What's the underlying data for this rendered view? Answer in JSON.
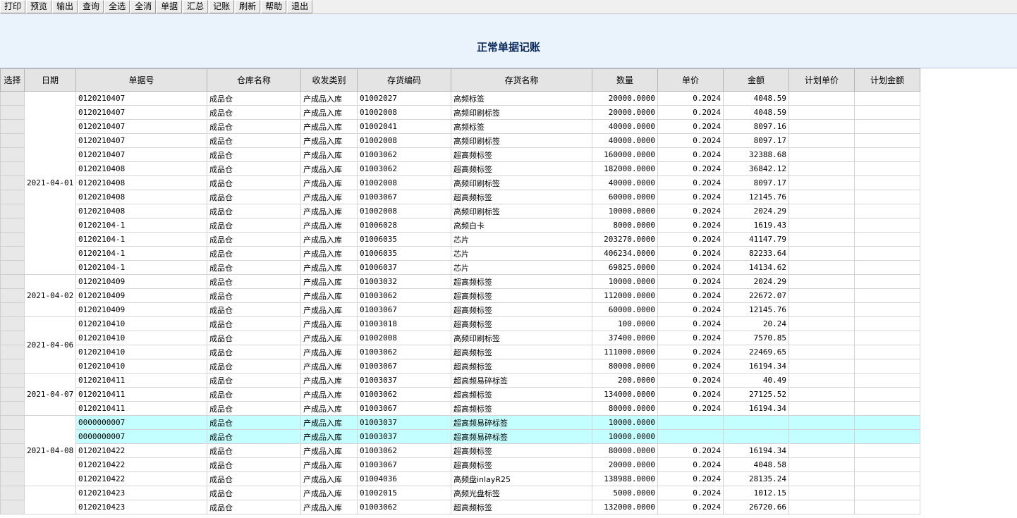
{
  "toolbar": {
    "buttons": [
      "打印",
      "预览",
      "输出",
      "查询",
      "全选",
      "全消",
      "单据",
      "汇总",
      "记账",
      "刷新",
      "帮助",
      "退出"
    ]
  },
  "page": {
    "title": "正常单据记账"
  },
  "table": {
    "columns": [
      "选择",
      "日期",
      "单据号",
      "仓库名称",
      "收发类别",
      "存货编码",
      "存货名称",
      "数量",
      "单价",
      "金额",
      "计划单价",
      "计划金额"
    ],
    "groups": [
      {
        "date": "2021-04-01",
        "rows": [
          {
            "no": "0120210407",
            "wh": "成品仓",
            "type": "产成品入库",
            "code": "01002027",
            "name": "高频标签",
            "qty": "20000.0000",
            "price": "0.2024",
            "amt": "4048.59",
            "hl": false
          },
          {
            "no": "0120210407",
            "wh": "成品仓",
            "type": "产成品入库",
            "code": "01002008",
            "name": "高频印刷标签",
            "qty": "20000.0000",
            "price": "0.2024",
            "amt": "4048.59",
            "hl": false
          },
          {
            "no": "0120210407",
            "wh": "成品仓",
            "type": "产成品入库",
            "code": "01002041",
            "name": "高频标签",
            "qty": "40000.0000",
            "price": "0.2024",
            "amt": "8097.16",
            "hl": false
          },
          {
            "no": "0120210407",
            "wh": "成品仓",
            "type": "产成品入库",
            "code": "01002008",
            "name": "高频印刷标签",
            "qty": "40000.0000",
            "price": "0.2024",
            "amt": "8097.17",
            "hl": false
          },
          {
            "no": "0120210407",
            "wh": "成品仓",
            "type": "产成品入库",
            "code": "01003062",
            "name": "超高频标签",
            "qty": "160000.0000",
            "price": "0.2024",
            "amt": "32388.68",
            "hl": false
          },
          {
            "no": "0120210408",
            "wh": "成品仓",
            "type": "产成品入库",
            "code": "01003062",
            "name": "超高频标签",
            "qty": "182000.0000",
            "price": "0.2024",
            "amt": "36842.12",
            "hl": false
          },
          {
            "no": "0120210408",
            "wh": "成品仓",
            "type": "产成品入库",
            "code": "01002008",
            "name": "高频印刷标签",
            "qty": "40000.0000",
            "price": "0.2024",
            "amt": "8097.17",
            "hl": false
          },
          {
            "no": "0120210408",
            "wh": "成品仓",
            "type": "产成品入库",
            "code": "01003067",
            "name": "超高频标签",
            "qty": "60000.0000",
            "price": "0.2024",
            "amt": "12145.76",
            "hl": false
          },
          {
            "no": "0120210408",
            "wh": "成品仓",
            "type": "产成品入库",
            "code": "01002008",
            "name": "高频印刷标签",
            "qty": "10000.0000",
            "price": "0.2024",
            "amt": "2024.29",
            "hl": false
          },
          {
            "no": "01202104-1",
            "wh": "成品仓",
            "type": "产成品入库",
            "code": "01006028",
            "name": "高频白卡",
            "qty": "8000.0000",
            "price": "0.2024",
            "amt": "1619.43",
            "hl": false
          },
          {
            "no": "01202104-1",
            "wh": "成品仓",
            "type": "产成品入库",
            "code": "01006035",
            "name": "芯片",
            "qty": "203270.0000",
            "price": "0.2024",
            "amt": "41147.79",
            "hl": false
          },
          {
            "no": "01202104-1",
            "wh": "成品仓",
            "type": "产成品入库",
            "code": "01006035",
            "name": "芯片",
            "qty": "406234.0000",
            "price": "0.2024",
            "amt": "82233.64",
            "hl": false
          },
          {
            "no": "01202104-1",
            "wh": "成品仓",
            "type": "产成品入库",
            "code": "01006037",
            "name": "芯片",
            "qty": "69825.0000",
            "price": "0.2024",
            "amt": "14134.62",
            "hl": false
          }
        ]
      },
      {
        "date": "2021-04-02",
        "rows": [
          {
            "no": "0120210409",
            "wh": "成品仓",
            "type": "产成品入库",
            "code": "01003032",
            "name": "超高频标签",
            "qty": "10000.0000",
            "price": "0.2024",
            "amt": "2024.29",
            "hl": false
          },
          {
            "no": "0120210409",
            "wh": "成品仓",
            "type": "产成品入库",
            "code": "01003062",
            "name": "超高频标签",
            "qty": "112000.0000",
            "price": "0.2024",
            "amt": "22672.07",
            "hl": false
          },
          {
            "no": "0120210409",
            "wh": "成品仓",
            "type": "产成品入库",
            "code": "01003067",
            "name": "超高频标签",
            "qty": "60000.0000",
            "price": "0.2024",
            "amt": "12145.76",
            "hl": false
          }
        ]
      },
      {
        "date": "2021-04-06",
        "rows": [
          {
            "no": "0120210410",
            "wh": "成品仓",
            "type": "产成品入库",
            "code": "01003018",
            "name": "超高频标签",
            "qty": "100.0000",
            "price": "0.2024",
            "amt": "20.24",
            "hl": false
          },
          {
            "no": "0120210410",
            "wh": "成品仓",
            "type": "产成品入库",
            "code": "01002008",
            "name": "高频印刷标签",
            "qty": "37400.0000",
            "price": "0.2024",
            "amt": "7570.85",
            "hl": false
          },
          {
            "no": "0120210410",
            "wh": "成品仓",
            "type": "产成品入库",
            "code": "01003062",
            "name": "超高频标签",
            "qty": "111000.0000",
            "price": "0.2024",
            "amt": "22469.65",
            "hl": false
          },
          {
            "no": "0120210410",
            "wh": "成品仓",
            "type": "产成品入库",
            "code": "01003067",
            "name": "超高频标签",
            "qty": "80000.0000",
            "price": "0.2024",
            "amt": "16194.34",
            "hl": false
          }
        ]
      },
      {
        "date": "2021-04-07",
        "rows": [
          {
            "no": "0120210411",
            "wh": "成品仓",
            "type": "产成品入库",
            "code": "01003037",
            "name": "超高频易碎标签",
            "qty": "200.0000",
            "price": "0.2024",
            "amt": "40.49",
            "hl": false
          },
          {
            "no": "0120210411",
            "wh": "成品仓",
            "type": "产成品入库",
            "code": "01003062",
            "name": "超高频标签",
            "qty": "134000.0000",
            "price": "0.2024",
            "amt": "27125.52",
            "hl": false
          },
          {
            "no": "0120210411",
            "wh": "成品仓",
            "type": "产成品入库",
            "code": "01003067",
            "name": "超高频标签",
            "qty": "80000.0000",
            "price": "0.2024",
            "amt": "16194.34",
            "hl": false
          }
        ]
      },
      {
        "date": "2021-04-08",
        "rows": [
          {
            "no": "0000000007",
            "wh": "成品仓",
            "type": "产成品入库",
            "code": "01003037",
            "name": "超高频易碎标签",
            "qty": "10000.0000",
            "price": "",
            "amt": "",
            "hl": true
          },
          {
            "no": "0000000007",
            "wh": "成品仓",
            "type": "产成品入库",
            "code": "01003037",
            "name": "超高频易碎标签",
            "qty": "10000.0000",
            "price": "",
            "amt": "",
            "hl": true
          },
          {
            "no": "0120210422",
            "wh": "成品仓",
            "type": "产成品入库",
            "code": "01003062",
            "name": "超高频标签",
            "qty": "80000.0000",
            "price": "0.2024",
            "amt": "16194.34",
            "hl": false
          },
          {
            "no": "0120210422",
            "wh": "成品仓",
            "type": "产成品入库",
            "code": "01003067",
            "name": "超高频标签",
            "qty": "20000.0000",
            "price": "0.2024",
            "amt": "4048.58",
            "hl": false
          },
          {
            "no": "0120210422",
            "wh": "成品仓",
            "type": "产成品入库",
            "code": "01004036",
            "name": "高频盘inlayR25",
            "qty": "138988.0000",
            "price": "0.2024",
            "amt": "28135.24",
            "hl": false
          }
        ]
      },
      {
        "date": "",
        "rows": [
          {
            "no": "0120210423",
            "wh": "成品仓",
            "type": "产成品入库",
            "code": "01002015",
            "name": "高频光盘标签",
            "qty": "5000.0000",
            "price": "0.2024",
            "amt": "1012.15",
            "hl": false
          },
          {
            "no": "0120210423",
            "wh": "成品仓",
            "type": "产成品入库",
            "code": "01003062",
            "name": "超高频标签",
            "qty": "132000.0000",
            "price": "0.2024",
            "amt": "26720.66",
            "hl": false
          }
        ]
      }
    ]
  }
}
